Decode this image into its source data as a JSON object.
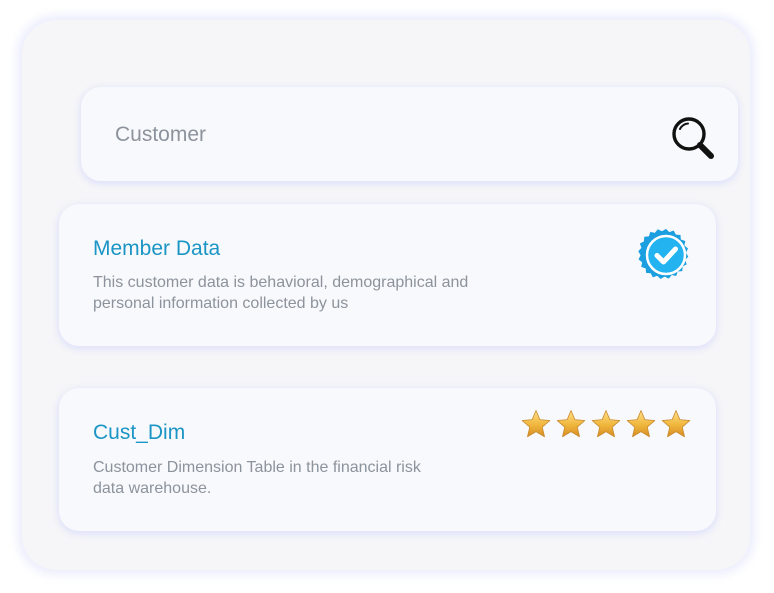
{
  "search": {
    "placeholder": "Customer",
    "value": ""
  },
  "results": [
    {
      "title": "Member Data",
      "description_lines": [
        "This customer data is behavioral, demographical and",
        "personal information collected by us"
      ],
      "badge": "verified-check-icon"
    },
    {
      "title": "Cust_Dim",
      "description_lines": [
        "Customer Dimension Table in the financial risk",
        "data warehouse."
      ],
      "rating": 5,
      "rating_max": 5
    }
  ],
  "colors": {
    "title": "#1b95c5",
    "muted_text": "#8c939c",
    "badge": "#1b9fe0",
    "star": "#f0b63c"
  }
}
